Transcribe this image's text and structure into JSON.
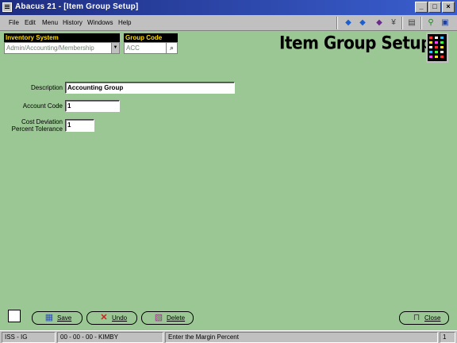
{
  "window": {
    "title": "Abacus 21 - [Item Group Setup]",
    "controls": {
      "minimize": "_",
      "maximize": "□",
      "close": "×"
    }
  },
  "menu": {
    "items": [
      "File",
      "Edit",
      "Menu",
      "History",
      "Windows",
      "Help"
    ]
  },
  "toolbar": {
    "icons": [
      "arrow-left-icon",
      "arrow-right-icon",
      "diamond-icon",
      "pin-icon",
      "calculator-icon",
      "running-man-icon",
      "exit-door-icon"
    ]
  },
  "inventory_system": {
    "label": "Inventory System",
    "value": "Admin/Accounting/Membership"
  },
  "group_code": {
    "label": "Group Code",
    "value": "ACC"
  },
  "page_title": "Item Group Setup",
  "form": {
    "description_label": "Description",
    "description_value": "Accounting Group",
    "account_code_label": "Account Code",
    "account_code_value": "1",
    "cost_deviation_label_1": "Cost Deviation",
    "cost_deviation_label_2": "Percent Tolerance",
    "cost_deviation_value": "1"
  },
  "buttons": {
    "save": "Save",
    "undo": "Undo",
    "delete": "Delete",
    "close": "Close"
  },
  "status": {
    "module": "ISS - IG",
    "session": "00 - 00 - 00 - KIMBY",
    "message": "Enter the Margin Percent",
    "page": "1"
  },
  "colors": {
    "background": "#9bc794",
    "label_bg": "#000000",
    "label_text": "#ffde00",
    "titlebar": "#1e2d80"
  }
}
